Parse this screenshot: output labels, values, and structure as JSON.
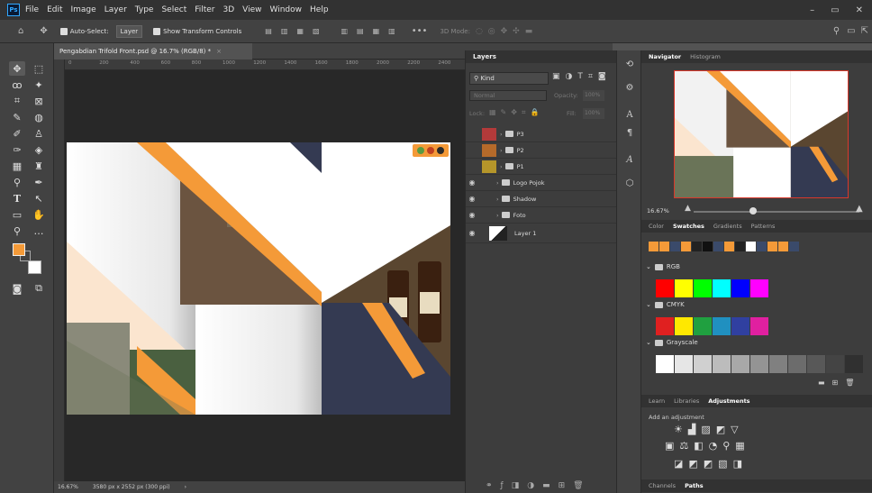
{
  "app": {
    "logo": "Ps"
  },
  "menu": [
    "File",
    "Edit",
    "Image",
    "Layer",
    "Type",
    "Select",
    "Filter",
    "3D",
    "View",
    "Window",
    "Help"
  ],
  "window_controls": [
    "–",
    "▭",
    "✕"
  ],
  "options_bar": {
    "auto_select_label": "Auto-Select:",
    "auto_select_target": "Layer",
    "transform_label": "Show Transform Controls",
    "three_d_mode": "3D Mode:"
  },
  "document": {
    "tab_title": "Pengabdian Trifold Front.psd @ 16.7% (RGB/8) *",
    "status_zoom": "16.67%",
    "status_info": "3580 px x 2552 px (300 ppi)"
  },
  "ruler_ticks": [
    "0",
    "200",
    "400",
    "600",
    "800",
    "1000",
    "1200",
    "1400",
    "1600",
    "1800",
    "2000",
    "2200",
    "2400",
    "2600",
    "2800",
    "3000",
    "3200",
    "3400"
  ],
  "layers": {
    "title": "Layers",
    "filter_kind": "Kind",
    "blend_mode": "Normal",
    "opacity_label": "Opacity:",
    "opacity_value": "100%",
    "lock_label": "Lock:",
    "fill_label": "Fill:",
    "fill_value": "100%",
    "items": [
      {
        "name": "P3",
        "color": "#b33a3a",
        "visible": false
      },
      {
        "name": "P2",
        "color": "#b56a2a",
        "visible": false
      },
      {
        "name": "P1",
        "color": "#b5962a",
        "visible": false
      },
      {
        "name": "Logo Pojok",
        "color": "",
        "visible": true
      },
      {
        "name": "Shadow",
        "color": "",
        "visible": true
      },
      {
        "name": "Foto",
        "color": "",
        "visible": true
      },
      {
        "name": "Layer 1",
        "color": "",
        "visible": true
      }
    ]
  },
  "navigator": {
    "tabs": [
      "Navigator",
      "Histogram"
    ],
    "zoom": "16.67%"
  },
  "swatches_panel": {
    "tabs": [
      "Color",
      "Swatches",
      "Gradients",
      "Patterns"
    ],
    "recent": [
      "#f49a38",
      "#f49a38",
      "#3a4a6a",
      "#f49a38",
      "#222222",
      "#111111",
      "#3a4a6a",
      "#f49a38",
      "#222222",
      "#ffffff",
      "#3a4a6a",
      "#f49a38",
      "#f49a38",
      "#3a4a6a"
    ],
    "groups": [
      {
        "name": "RGB",
        "colors": [
          "#ff0000",
          "#ffff00",
          "#00ff00",
          "#00ffff",
          "#0000ff",
          "#ff00ff"
        ]
      },
      {
        "name": "CMYK",
        "colors": [
          "#e02020",
          "#ffe800",
          "#20a040",
          "#2090c0",
          "#3040a0",
          "#e020a0"
        ]
      },
      {
        "name": "Grayscale",
        "colors": [
          "#ffffff",
          "#e6e6e6",
          "#d0d0d0",
          "#bcbcbc",
          "#a8a8a8",
          "#949494",
          "#808080",
          "#6c6c6c",
          "#585858",
          "#444444",
          "#303030"
        ]
      }
    ]
  },
  "adjustments_panel": {
    "tabs": [
      "Learn",
      "Libraries",
      "Adjustments"
    ],
    "add_label": "Add an adjustment"
  },
  "bottom_tabs": [
    "Channels",
    "Paths"
  ],
  "colors": {
    "foreground": "#f49a38",
    "background": "#ffffff",
    "accent": "#f49a38",
    "navy": "#343a52"
  }
}
